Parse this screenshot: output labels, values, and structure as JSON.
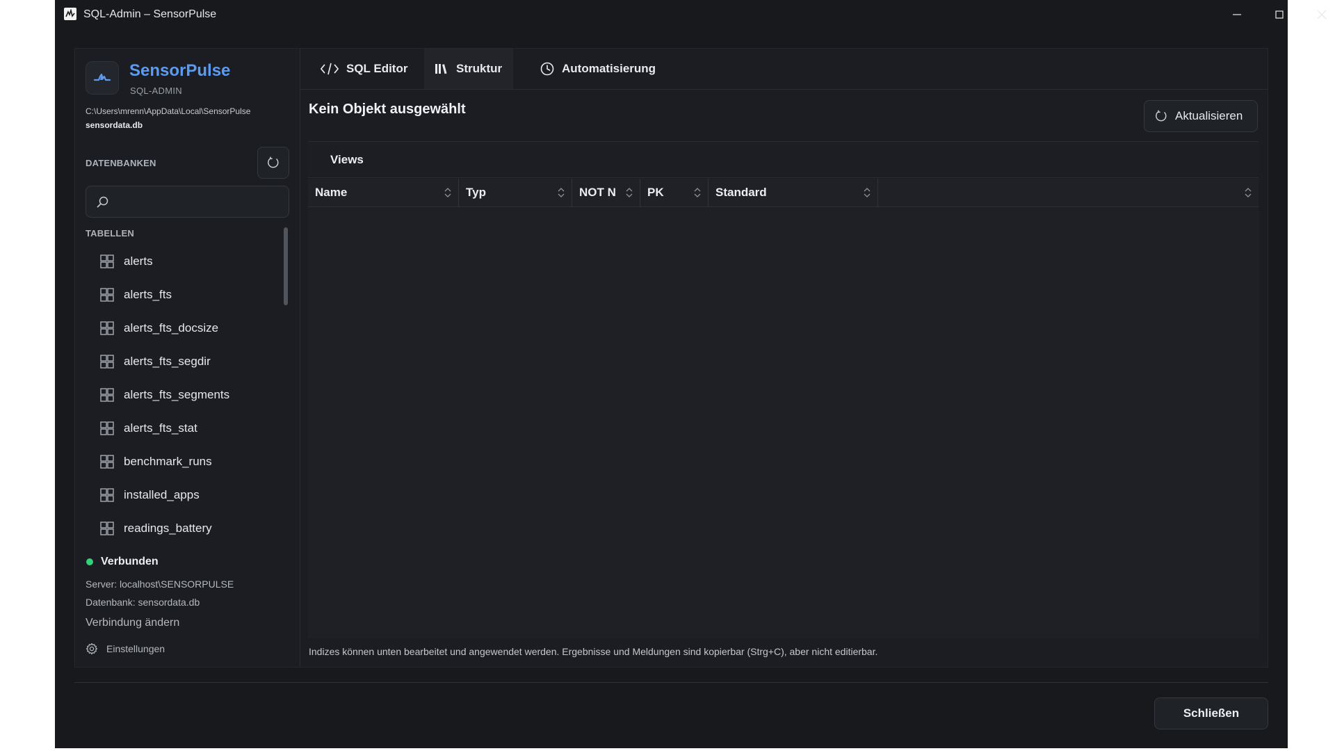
{
  "window": {
    "title": "SQL-Admin – SensorPulse"
  },
  "sidebar": {
    "brand_name": "SensorPulse",
    "brand_sub": "SQL-ADMIN",
    "db_path": "C:\\Users\\mrenn\\AppData\\Local\\SensorPulse",
    "db_file": "sensordata.db",
    "databases_label": "DATENBANKEN",
    "search_placeholder": "",
    "tables_label": "TABELLEN",
    "tables": [
      {
        "label": "alerts"
      },
      {
        "label": "alerts_fts"
      },
      {
        "label": "alerts_fts_docsize"
      },
      {
        "label": "alerts_fts_segdir"
      },
      {
        "label": "alerts_fts_segments"
      },
      {
        "label": "alerts_fts_stat"
      },
      {
        "label": "benchmark_runs"
      },
      {
        "label": "installed_apps"
      },
      {
        "label": "readings_battery"
      }
    ],
    "status": "Verbunden",
    "status_color": "#2fd37a",
    "server": "Server: localhost\\SENSORPULSE",
    "database": "Datenbank: sensordata.db",
    "change_connection": "Verbindung ändern",
    "settings": "Einstellungen"
  },
  "main": {
    "tabs": [
      {
        "label": "SQL Editor",
        "icon": "code-icon",
        "active": false
      },
      {
        "label": "Struktur",
        "icon": "books-icon",
        "active": true
      },
      {
        "label": "Automatisierung",
        "icon": "clock-icon",
        "active": false
      }
    ],
    "object_title": "Kein Objekt ausgewählt",
    "refresh_label": "Aktualisieren",
    "section_label": "Views",
    "columns": [
      "Name",
      "Typ",
      "NOT N",
      "PK",
      "Standard",
      ""
    ],
    "footnote": "Indizes können unten bearbeitet und angewendet werden. Ergebnisse und Meldungen sind kopierbar (Strg+C), aber nicht editierbar."
  },
  "footer": {
    "close_label": "Schließen"
  },
  "colors": {
    "accent": "#5b9bf0",
    "background": "#17191d"
  }
}
